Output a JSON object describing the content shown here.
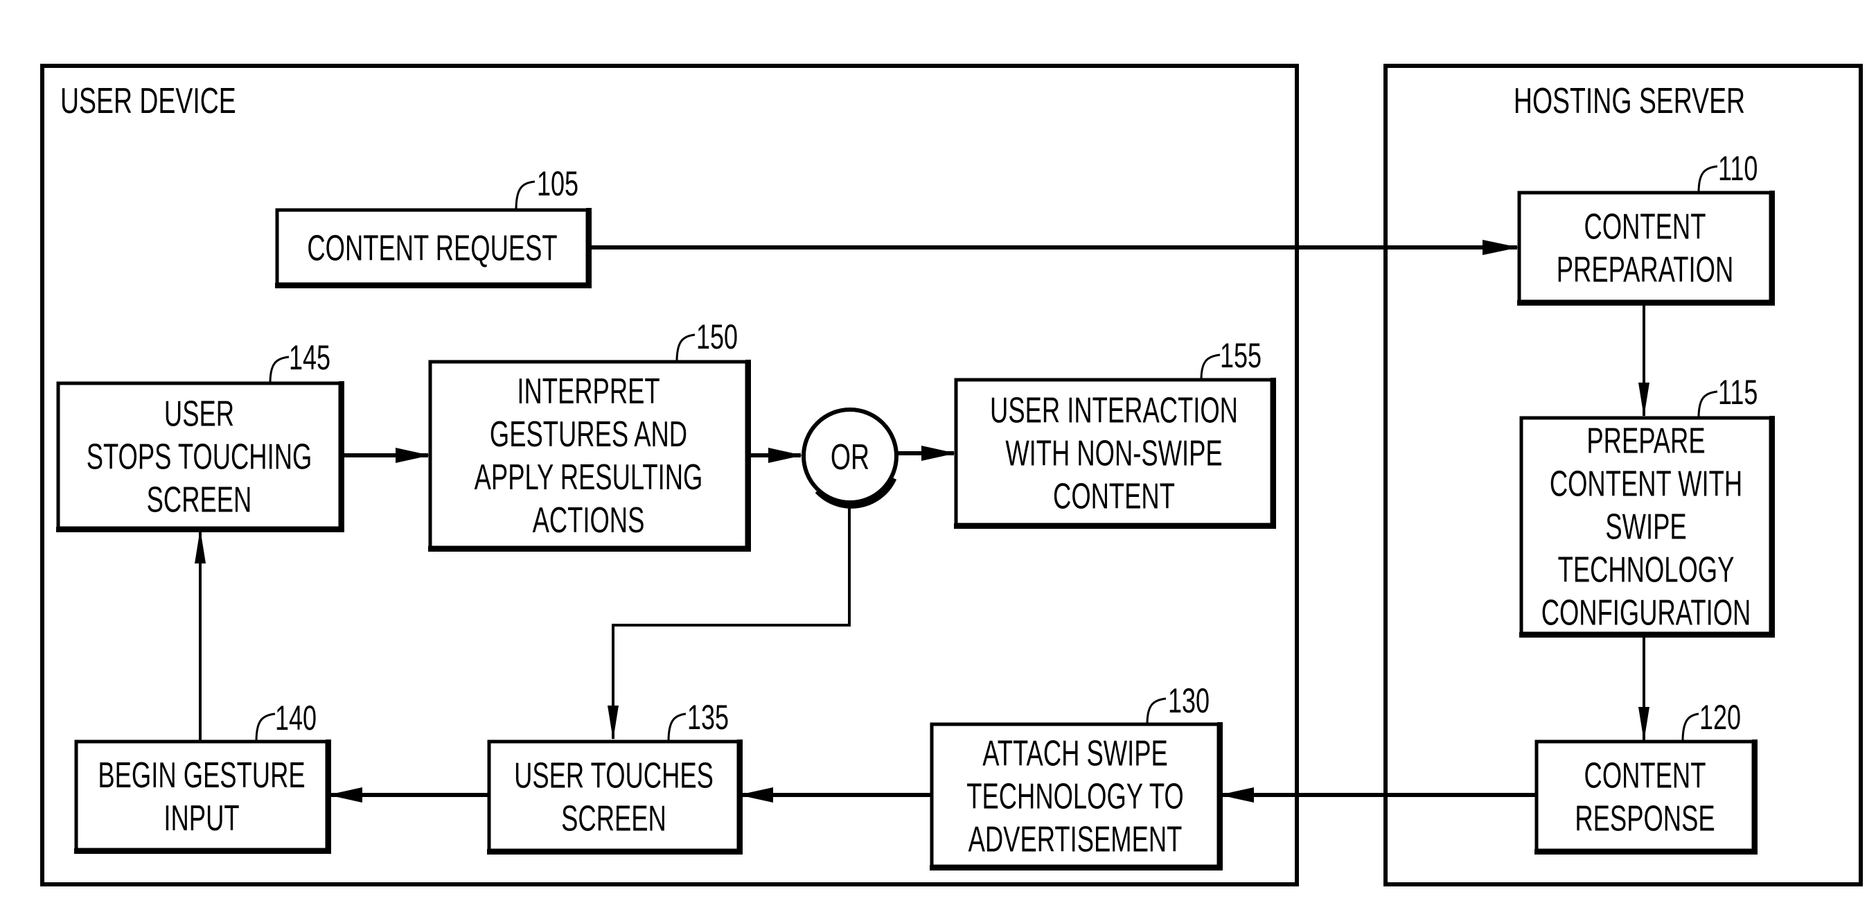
{
  "diagram": {
    "type": "flowchart",
    "colors": {
      "ink": "#000000",
      "background": "#ffffff"
    },
    "regions": [
      {
        "id": "user-device",
        "title": "USER DEVICE"
      },
      {
        "id": "hosting-server",
        "title": "HOSTING SERVER"
      }
    ],
    "nodes": [
      {
        "id": "105",
        "ref": "105",
        "region": "user-device",
        "lines": [
          "CONTENT REQUEST"
        ]
      },
      {
        "id": "110",
        "ref": "110",
        "region": "hosting-server",
        "lines": [
          "CONTENT",
          "PREPARATION"
        ]
      },
      {
        "id": "115",
        "ref": "115",
        "region": "hosting-server",
        "lines": [
          "PREPARE",
          "CONTENT WITH",
          "SWIPE",
          "TECHNOLOGY",
          "CONFIGURATION"
        ]
      },
      {
        "id": "120",
        "ref": "120",
        "region": "hosting-server",
        "lines": [
          "CONTENT",
          "RESPONSE"
        ]
      },
      {
        "id": "130",
        "ref": "130",
        "region": "user-device",
        "lines": [
          "ATTACH SWIPE",
          "TECHNOLOGY TO",
          "ADVERTISEMENT"
        ]
      },
      {
        "id": "135",
        "ref": "135",
        "region": "user-device",
        "lines": [
          "USER TOUCHES",
          "SCREEN"
        ]
      },
      {
        "id": "140",
        "ref": "140",
        "region": "user-device",
        "lines": [
          "BEGIN GESTURE",
          "INPUT"
        ]
      },
      {
        "id": "145",
        "ref": "145",
        "region": "user-device",
        "lines": [
          "USER",
          "STOPS TOUCHING",
          "SCREEN"
        ]
      },
      {
        "id": "150",
        "ref": "150",
        "region": "user-device",
        "lines": [
          "INTERPRET",
          "GESTURES AND",
          "APPLY RESULTING",
          "ACTIONS"
        ]
      },
      {
        "id": "155",
        "ref": "155",
        "region": "user-device",
        "lines": [
          "USER INTERACTION",
          "WITH NON-SWIPE",
          "CONTENT"
        ]
      }
    ],
    "decision": {
      "id": "or",
      "label": "OR"
    },
    "edges": [
      {
        "from": "105",
        "to": "110"
      },
      {
        "from": "110",
        "to": "115"
      },
      {
        "from": "115",
        "to": "120"
      },
      {
        "from": "120",
        "to": "130"
      },
      {
        "from": "130",
        "to": "135"
      },
      {
        "from": "135",
        "to": "140"
      },
      {
        "from": "140",
        "to": "145"
      },
      {
        "from": "145",
        "to": "150"
      },
      {
        "from": "150",
        "to": "or"
      },
      {
        "from": "or",
        "to": "155"
      },
      {
        "from": "or",
        "to": "135"
      }
    ]
  }
}
